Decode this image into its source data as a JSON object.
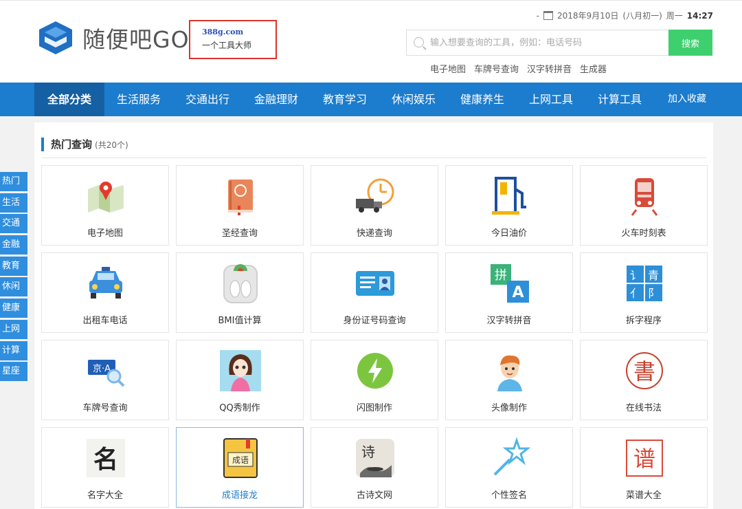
{
  "site": {
    "brand": "随便吧GO",
    "promo_domain": "388g.com",
    "promo_slogan": "一个工具大师"
  },
  "header": {
    "date_prefix": "-",
    "date": "2018年9月10日",
    "lunar": "(八月初一)",
    "weekday": "周一",
    "time": "14:27"
  },
  "search": {
    "placeholder": "输入想要查询的工具，例如：电话号码",
    "button": "搜索",
    "hot_links": [
      "电子地图",
      "车牌号查询",
      "汉字转拼音",
      "生成器"
    ]
  },
  "nav": {
    "items": [
      "全部分类",
      "生活服务",
      "交通出行",
      "金融理财",
      "教育学习",
      "休闲娱乐",
      "健康养生",
      "上网工具",
      "计算工具",
      "加入收藏"
    ],
    "active": "全部分类"
  },
  "side_tabs": [
    "热门",
    "生活",
    "交通",
    "金融",
    "教育",
    "休闲",
    "健康",
    "上网",
    "计算",
    "星座"
  ],
  "section": {
    "title": "热门查询",
    "count": "(共20个)"
  },
  "tools": [
    {
      "label": "电子地图",
      "icon": "map-icon"
    },
    {
      "label": "圣经查询",
      "icon": "bible-icon"
    },
    {
      "label": "快递查询",
      "icon": "delivery-truck-icon"
    },
    {
      "label": "今日油价",
      "icon": "fuel-pump-icon"
    },
    {
      "label": "火车时刻表",
      "icon": "train-icon"
    },
    {
      "label": "出租车电话",
      "icon": "taxi-icon"
    },
    {
      "label": "BMI值计算",
      "icon": "scale-icon"
    },
    {
      "label": "身份证号码查询",
      "icon": "id-card-icon"
    },
    {
      "label": "汉字转拼音",
      "icon": "pinyin-icon"
    },
    {
      "label": "拆字程序",
      "icon": "split-character-icon"
    },
    {
      "label": "车牌号查询",
      "icon": "license-plate-icon"
    },
    {
      "label": "QQ秀制作",
      "icon": "qq-show-girl-icon"
    },
    {
      "label": "闪图制作",
      "icon": "lightning-icon"
    },
    {
      "label": "头像制作",
      "icon": "avatar-boy-icon"
    },
    {
      "label": "在线书法",
      "icon": "calligraphy-seal-icon"
    },
    {
      "label": "名字大全",
      "icon": "name-calligraphy-icon"
    },
    {
      "label": "成语接龙",
      "icon": "idiom-book-icon"
    },
    {
      "label": "古诗文网",
      "icon": "poetry-ink-icon"
    },
    {
      "label": "个性签名",
      "icon": "signature-star-icon"
    },
    {
      "label": "菜谱大全",
      "icon": "recipe-seal-icon"
    }
  ],
  "colors": {
    "nav_blue": "#1c7ccd",
    "nav_active": "#155fa3",
    "search_green": "#3ecf6e",
    "promo_border": "#d9342b"
  }
}
